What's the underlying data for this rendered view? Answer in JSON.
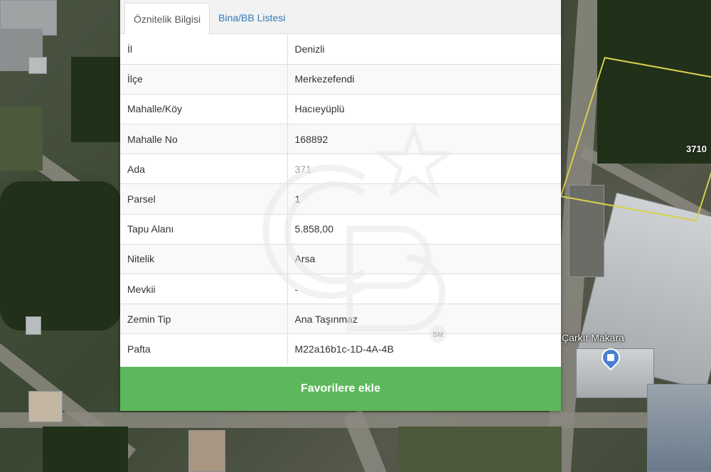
{
  "map": {
    "parcel_label": "3710",
    "poi_label": "Çarkıt Makara",
    "poi_icon": "shopping-bag-icon"
  },
  "tabs": [
    {
      "label": "Öznitelik Bilgisi",
      "active": true
    },
    {
      "label": "Bina/BB Listesi",
      "active": false
    }
  ],
  "attributes": [
    {
      "key": "İl",
      "value": "Denizli"
    },
    {
      "key": "İlçe",
      "value": "Merkezefendi"
    },
    {
      "key": "Mahalle/Köy",
      "value": "Hacıeyüplü"
    },
    {
      "key": "Mahalle No",
      "value": "168892"
    },
    {
      "key": "Ada",
      "value": "371"
    },
    {
      "key": "Parsel",
      "value": "1"
    },
    {
      "key": "Tapu Alanı",
      "value": "5.858,00"
    },
    {
      "key": "Nitelik",
      "value": "Arsa"
    },
    {
      "key": "Mevkii",
      "value": "-"
    },
    {
      "key": "Zemin Tip",
      "value": "Ana Taşınmaz"
    },
    {
      "key": "Pafta",
      "value": "M22a16b1c-1D-4A-4B"
    }
  ],
  "favorite_button": "Favorilere ekle",
  "watermark": {
    "mark": "SM"
  },
  "colors": {
    "accent": "#5cb85c",
    "link": "#337ab7",
    "parcel": "#d8d04a"
  }
}
